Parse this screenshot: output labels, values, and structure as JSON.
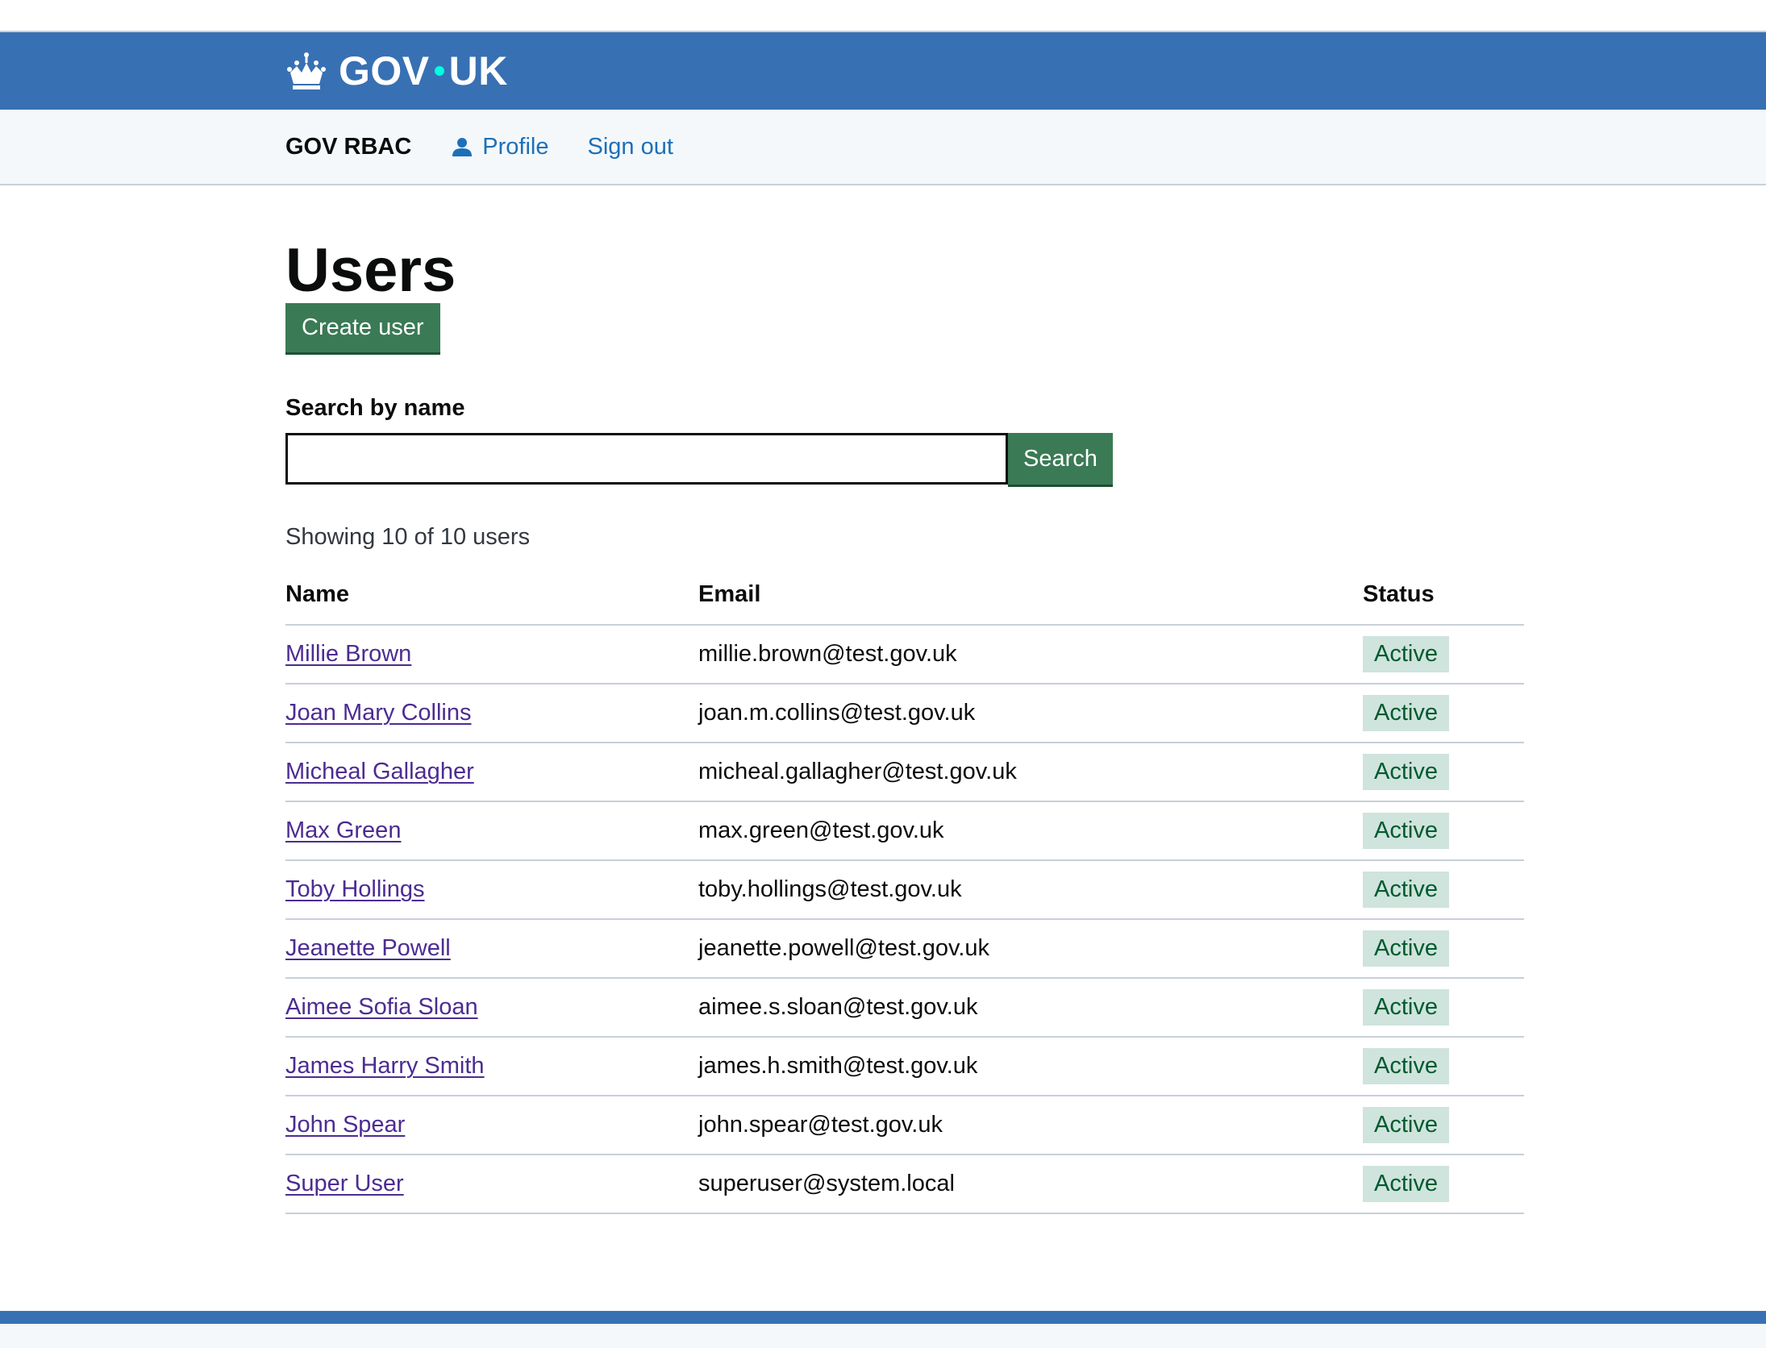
{
  "header": {
    "logo_text_left": "GOV",
    "logo_text_right": "UK"
  },
  "service_nav": {
    "service_name": "GOV RBAC",
    "profile_label": "Profile",
    "signout_label": "Sign out"
  },
  "page": {
    "title": "Users",
    "create_button": "Create user"
  },
  "search": {
    "label": "Search by name",
    "value": "",
    "placeholder": "",
    "button": "Search"
  },
  "results": {
    "count_text": "Showing 10 of 10 users"
  },
  "table": {
    "headers": {
      "name": "Name",
      "email": "Email",
      "status": "Status"
    },
    "rows": [
      {
        "name": "Millie Brown",
        "email": "millie.brown@test.gov.uk",
        "status": "Active"
      },
      {
        "name": "Joan Mary Collins",
        "email": "joan.m.collins@test.gov.uk",
        "status": "Active"
      },
      {
        "name": "Micheal Gallagher",
        "email": "micheal.gallagher@test.gov.uk",
        "status": "Active"
      },
      {
        "name": "Max Green",
        "email": "max.green@test.gov.uk",
        "status": "Active"
      },
      {
        "name": "Toby Hollings",
        "email": "toby.hollings@test.gov.uk",
        "status": "Active"
      },
      {
        "name": "Jeanette Powell",
        "email": "jeanette.powell@test.gov.uk",
        "status": "Active"
      },
      {
        "name": "Aimee Sofia Sloan",
        "email": "aimee.s.sloan@test.gov.uk",
        "status": "Active"
      },
      {
        "name": "James Harry Smith",
        "email": "james.h.smith@test.gov.uk",
        "status": "Active"
      },
      {
        "name": "John Spear",
        "email": "john.spear@test.gov.uk",
        "status": "Active"
      },
      {
        "name": "Super User",
        "email": "superuser@system.local",
        "status": "Active"
      }
    ]
  },
  "icons": {
    "logo": "crown-icon",
    "profile": "person-icon"
  },
  "colors": {
    "header_blue": "#3870b4",
    "button_green": "#3a7a55",
    "link_purple": "#4c2c92",
    "nav_link_blue": "#1d70b8",
    "tag_bg": "#cfe4dc"
  }
}
